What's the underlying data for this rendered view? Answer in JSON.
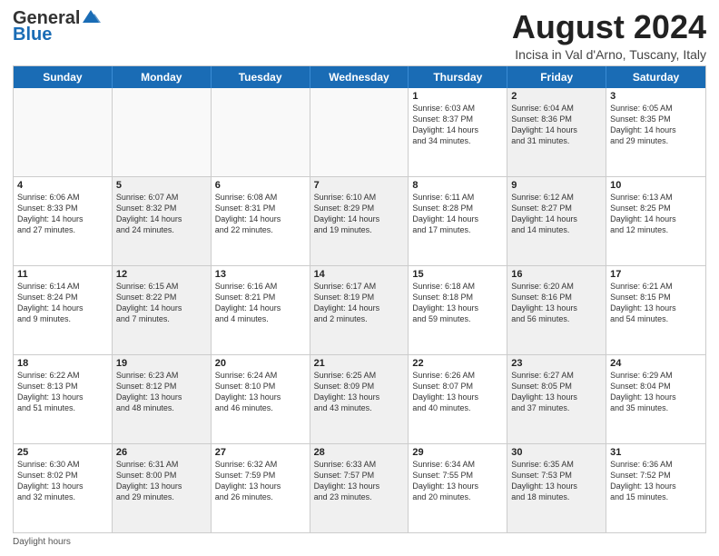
{
  "logo": {
    "general": "General",
    "blue": "Blue"
  },
  "title": "August 2024",
  "location": "Incisa in Val d'Arno, Tuscany, Italy",
  "days_of_week": [
    "Sunday",
    "Monday",
    "Tuesday",
    "Wednesday",
    "Thursday",
    "Friday",
    "Saturday"
  ],
  "footer": "Daylight hours",
  "rows": [
    [
      {
        "day": "",
        "text": "",
        "empty": true
      },
      {
        "day": "",
        "text": "",
        "empty": true
      },
      {
        "day": "",
        "text": "",
        "empty": true
      },
      {
        "day": "",
        "text": "",
        "empty": true
      },
      {
        "day": "1",
        "text": "Sunrise: 6:03 AM\nSunset: 8:37 PM\nDaylight: 14 hours\nand 34 minutes.",
        "shaded": false
      },
      {
        "day": "2",
        "text": "Sunrise: 6:04 AM\nSunset: 8:36 PM\nDaylight: 14 hours\nand 31 minutes.",
        "shaded": true
      },
      {
        "day": "3",
        "text": "Sunrise: 6:05 AM\nSunset: 8:35 PM\nDaylight: 14 hours\nand 29 minutes.",
        "shaded": false
      }
    ],
    [
      {
        "day": "4",
        "text": "Sunrise: 6:06 AM\nSunset: 8:33 PM\nDaylight: 14 hours\nand 27 minutes.",
        "shaded": false
      },
      {
        "day": "5",
        "text": "Sunrise: 6:07 AM\nSunset: 8:32 PM\nDaylight: 14 hours\nand 24 minutes.",
        "shaded": true
      },
      {
        "day": "6",
        "text": "Sunrise: 6:08 AM\nSunset: 8:31 PM\nDaylight: 14 hours\nand 22 minutes.",
        "shaded": false
      },
      {
        "day": "7",
        "text": "Sunrise: 6:10 AM\nSunset: 8:29 PM\nDaylight: 14 hours\nand 19 minutes.",
        "shaded": true
      },
      {
        "day": "8",
        "text": "Sunrise: 6:11 AM\nSunset: 8:28 PM\nDaylight: 14 hours\nand 17 minutes.",
        "shaded": false
      },
      {
        "day": "9",
        "text": "Sunrise: 6:12 AM\nSunset: 8:27 PM\nDaylight: 14 hours\nand 14 minutes.",
        "shaded": true
      },
      {
        "day": "10",
        "text": "Sunrise: 6:13 AM\nSunset: 8:25 PM\nDaylight: 14 hours\nand 12 minutes.",
        "shaded": false
      }
    ],
    [
      {
        "day": "11",
        "text": "Sunrise: 6:14 AM\nSunset: 8:24 PM\nDaylight: 14 hours\nand 9 minutes.",
        "shaded": false
      },
      {
        "day": "12",
        "text": "Sunrise: 6:15 AM\nSunset: 8:22 PM\nDaylight: 14 hours\nand 7 minutes.",
        "shaded": true
      },
      {
        "day": "13",
        "text": "Sunrise: 6:16 AM\nSunset: 8:21 PM\nDaylight: 14 hours\nand 4 minutes.",
        "shaded": false
      },
      {
        "day": "14",
        "text": "Sunrise: 6:17 AM\nSunset: 8:19 PM\nDaylight: 14 hours\nand 2 minutes.",
        "shaded": true
      },
      {
        "day": "15",
        "text": "Sunrise: 6:18 AM\nSunset: 8:18 PM\nDaylight: 13 hours\nand 59 minutes.",
        "shaded": false
      },
      {
        "day": "16",
        "text": "Sunrise: 6:20 AM\nSunset: 8:16 PM\nDaylight: 13 hours\nand 56 minutes.",
        "shaded": true
      },
      {
        "day": "17",
        "text": "Sunrise: 6:21 AM\nSunset: 8:15 PM\nDaylight: 13 hours\nand 54 minutes.",
        "shaded": false
      }
    ],
    [
      {
        "day": "18",
        "text": "Sunrise: 6:22 AM\nSunset: 8:13 PM\nDaylight: 13 hours\nand 51 minutes.",
        "shaded": false
      },
      {
        "day": "19",
        "text": "Sunrise: 6:23 AM\nSunset: 8:12 PM\nDaylight: 13 hours\nand 48 minutes.",
        "shaded": true
      },
      {
        "day": "20",
        "text": "Sunrise: 6:24 AM\nSunset: 8:10 PM\nDaylight: 13 hours\nand 46 minutes.",
        "shaded": false
      },
      {
        "day": "21",
        "text": "Sunrise: 6:25 AM\nSunset: 8:09 PM\nDaylight: 13 hours\nand 43 minutes.",
        "shaded": true
      },
      {
        "day": "22",
        "text": "Sunrise: 6:26 AM\nSunset: 8:07 PM\nDaylight: 13 hours\nand 40 minutes.",
        "shaded": false
      },
      {
        "day": "23",
        "text": "Sunrise: 6:27 AM\nSunset: 8:05 PM\nDaylight: 13 hours\nand 37 minutes.",
        "shaded": true
      },
      {
        "day": "24",
        "text": "Sunrise: 6:29 AM\nSunset: 8:04 PM\nDaylight: 13 hours\nand 35 minutes.",
        "shaded": false
      }
    ],
    [
      {
        "day": "25",
        "text": "Sunrise: 6:30 AM\nSunset: 8:02 PM\nDaylight: 13 hours\nand 32 minutes.",
        "shaded": false
      },
      {
        "day": "26",
        "text": "Sunrise: 6:31 AM\nSunset: 8:00 PM\nDaylight: 13 hours\nand 29 minutes.",
        "shaded": true
      },
      {
        "day": "27",
        "text": "Sunrise: 6:32 AM\nSunset: 7:59 PM\nDaylight: 13 hours\nand 26 minutes.",
        "shaded": false
      },
      {
        "day": "28",
        "text": "Sunrise: 6:33 AM\nSunset: 7:57 PM\nDaylight: 13 hours\nand 23 minutes.",
        "shaded": true
      },
      {
        "day": "29",
        "text": "Sunrise: 6:34 AM\nSunset: 7:55 PM\nDaylight: 13 hours\nand 20 minutes.",
        "shaded": false
      },
      {
        "day": "30",
        "text": "Sunrise: 6:35 AM\nSunset: 7:53 PM\nDaylight: 13 hours\nand 18 minutes.",
        "shaded": true
      },
      {
        "day": "31",
        "text": "Sunrise: 6:36 AM\nSunset: 7:52 PM\nDaylight: 13 hours\nand 15 minutes.",
        "shaded": false
      }
    ]
  ]
}
